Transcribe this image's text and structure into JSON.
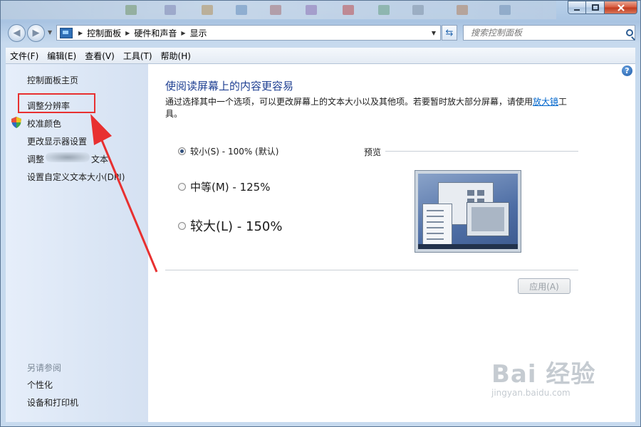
{
  "breadcrumb": [
    "控制面板",
    "硬件和声音",
    "显示"
  ],
  "search": {
    "placeholder": "搜索控制面板"
  },
  "menu": [
    "文件(F)",
    "编辑(E)",
    "查看(V)",
    "工具(T)",
    "帮助(H)"
  ],
  "sidebar": {
    "items": [
      {
        "label": "控制面板主页"
      },
      {
        "label": "调整分辨率"
      },
      {
        "label": "校准颜色",
        "icon": "shield-icon"
      },
      {
        "label": "更改显示器设置"
      },
      {
        "label_start": "调整",
        "label_end": "文本"
      },
      {
        "label": "设置自定义文本大小(DPI)"
      }
    ],
    "see_also_title": "另请参阅",
    "see_also": [
      "个性化",
      "设备和打印机"
    ]
  },
  "main": {
    "heading": "使阅读屏幕上的内容更容易",
    "description_before": "通过选择其中一个选项，可以更改屏幕上的文本大小以及其他项。若要暂时放大部分屏幕，请使用",
    "description_link": "放大镜",
    "description_after": "工具。",
    "options": [
      {
        "label": "较小(S) - 100% (默认)",
        "selected": true
      },
      {
        "label": "中等(M) - 125%",
        "selected": false
      },
      {
        "label": "较大(L) - 150%",
        "selected": false
      }
    ],
    "preview_label": "预览",
    "apply_label": "应用(A)",
    "apply_enabled": false
  },
  "watermark": {
    "main": "Bai 经验",
    "sub": "jingyan.baidu.com"
  },
  "colors": {
    "highlight_box": "#e83030",
    "arrow": "#e83030",
    "heading": "#1e3f92",
    "link": "#0066cc"
  }
}
